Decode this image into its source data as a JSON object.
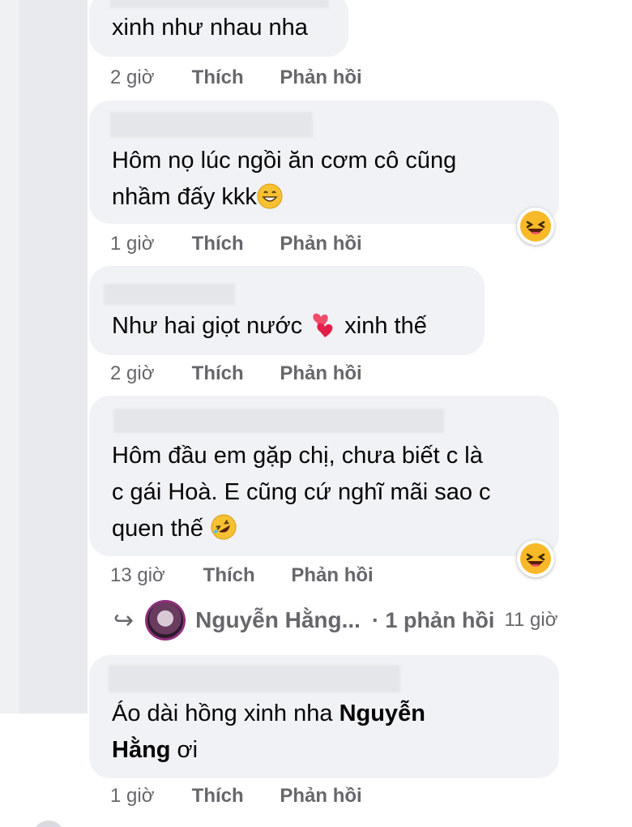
{
  "comments": [
    {
      "lines": [
        "xinh như nhau nha"
      ],
      "time": "2 giờ",
      "like": "Thích",
      "reply": "Phản hồi"
    },
    {
      "lines": [
        "Hôm nọ lúc ngồi ăn cơm cô cũng",
        "nhầm đấy kkk"
      ],
      "time": "1 giờ",
      "like": "Thích",
      "reply": "Phản hồi",
      "reaction": "haha"
    },
    {
      "lines": [
        "Như hai giọt nước",
        "xinh thế"
      ],
      "time": "2 giờ",
      "like": "Thích",
      "reply": "Phản hồi"
    },
    {
      "lines": [
        "Hôm đầu em gặp chị, chưa biết c là",
        "c gái Hoà. E cũng cứ nghĩ mãi sao c",
        "quen thế"
      ],
      "time": "13 giờ",
      "like": "Thích",
      "reply": "Phản hồi",
      "reaction": "haha",
      "replies_summary": {
        "name": "Nguyễn Hằng...",
        "count": "· 1 phản hồi",
        "time": "11 giờ"
      }
    },
    {
      "text_prefix": "Áo dài hồng xinh nha ",
      "mention_part1": "Nguyễn",
      "mention_part2": "Hằng",
      "text_suffix": " ơi",
      "time": "1 giờ",
      "like": "Thích",
      "reply": "Phản hồi"
    }
  ],
  "icons": {
    "reaction": "laughing-face-icon",
    "grin": "grinning-face-icon",
    "hearts": "two-hearts-icon",
    "rofl": "rolling-on-floor-laughing-icon",
    "reply_arrow": "reply-arrow-icon"
  },
  "colors": {
    "bubble": "#f0f2f5",
    "meta": "#65676b",
    "text": "#050505"
  }
}
